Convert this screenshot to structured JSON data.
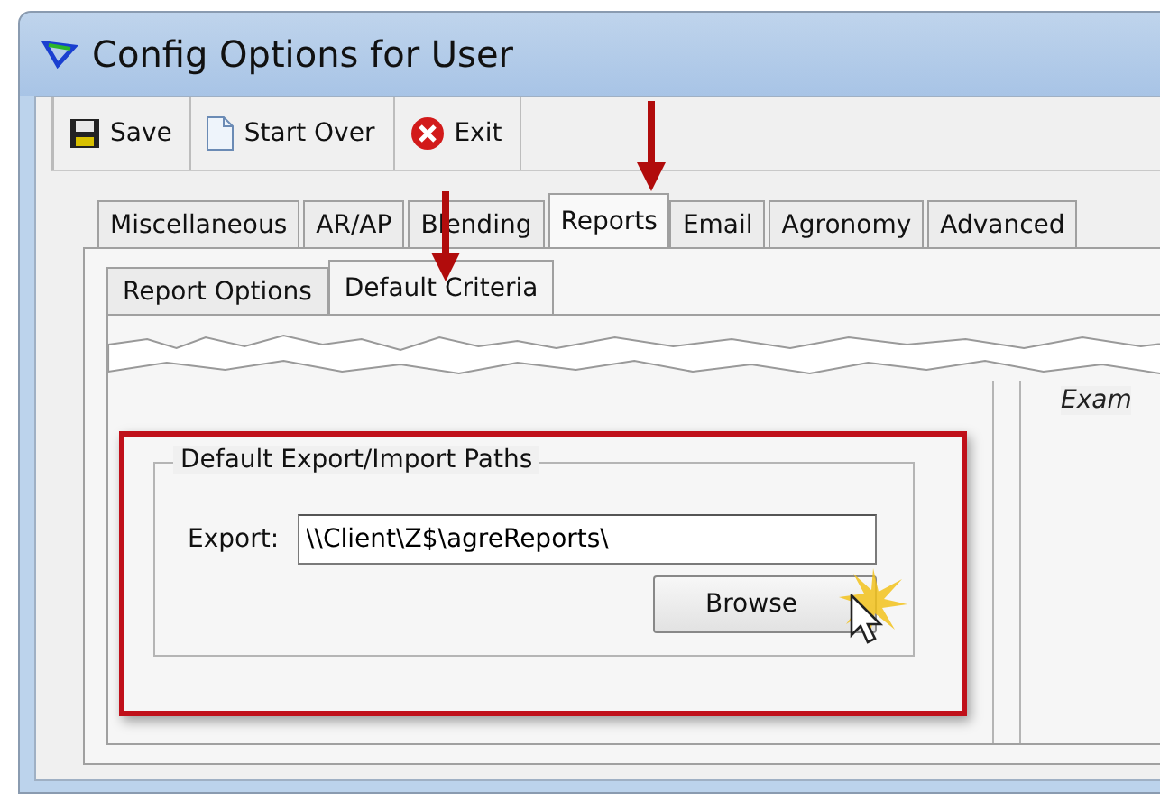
{
  "window": {
    "title": "Config Options for User"
  },
  "toolbar": [
    {
      "label": "Save",
      "kind": "save"
    },
    {
      "label": "Start Over",
      "kind": "new"
    },
    {
      "label": "Exit",
      "kind": "exit"
    }
  ],
  "tabs": [
    {
      "label": "Miscellaneous",
      "selected": false
    },
    {
      "label": "AR/AP",
      "selected": false
    },
    {
      "label": "Blending",
      "selected": false
    },
    {
      "label": "Reports",
      "selected": true
    },
    {
      "label": "Email",
      "selected": false
    },
    {
      "label": "Agronomy",
      "selected": false
    },
    {
      "label": "Advanced",
      "selected": false
    }
  ],
  "subtabs": [
    {
      "label": "Report Options",
      "selected": false
    },
    {
      "label": "Default Criteria",
      "selected": true
    }
  ],
  "group": {
    "title": "Default Export/Import Paths",
    "export_label": "Export:",
    "export_value": "\\\\Client\\Z$\\agreReports\\",
    "browse": "Browse"
  },
  "side_panel": {
    "text": "Exam"
  }
}
